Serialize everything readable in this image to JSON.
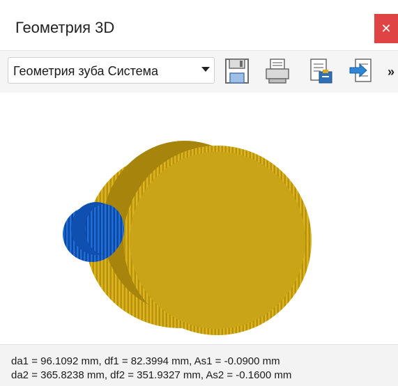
{
  "window": {
    "title": "Геометрия 3D",
    "close_icon": "close-icon"
  },
  "toolbar": {
    "view_select": {
      "value": "Геометрия зуба Система"
    },
    "icons": [
      "save-icon",
      "print-icon",
      "clipboard-icon",
      "export-icon"
    ],
    "overflow_label": "»"
  },
  "viewport": {
    "gear1_color": "#1565c0",
    "gear2_color": "#c8a416"
  },
  "status": {
    "line1": "da1 = 96.1092 mm, df1 = 82.3994 mm, As1 = -0.0900 mm",
    "line2": "da2 = 365.8238 mm, df2 = 351.9327 mm, As2 = -0.1600 mm"
  }
}
